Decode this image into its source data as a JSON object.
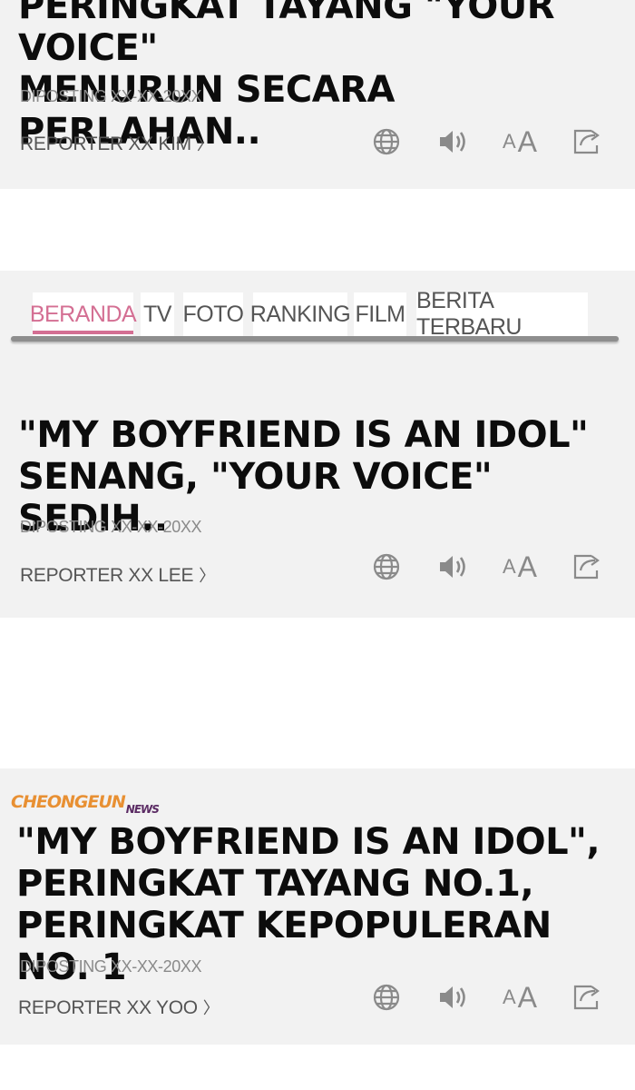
{
  "articles": [
    {
      "headline": "PERINGKAT TAYANG \"YOUR VOICE\"\nMENURUN SECARA PERLAHAN..",
      "date": "DIPOSTING XX-XX-20XX",
      "reporter": "REPORTER XX KIM",
      "chevron": "〉"
    },
    {
      "headline": "\"MY BOYFRIEND IS AN IDOL\"\nSENANG, \"YOUR VOICE\" SEDIH..",
      "date": "DIPOSTING XX-XX-20XX",
      "reporter": "REPORTER XX LEE",
      "chevron": "〉"
    },
    {
      "headline": "\"MY BOYFRIEND IS AN IDOL\",\nPERINGKAT TAYANG NO.1,\nPERINGKAT KEPOPULERAN NO. 1",
      "date": "DIPOSTING XX-XX-20XX",
      "reporter": "REPORTER XX YOO",
      "chevron": "〉"
    }
  ],
  "tools": {
    "icons": [
      "globe-icon",
      "speaker-icon",
      "font-size-icon",
      "share-icon"
    ],
    "font_small": "A",
    "font_big": "A"
  },
  "nav": {
    "tabs": [
      "BERANDA",
      "TV",
      "FOTO",
      "RANKING",
      "FILM",
      "BERITA TERBARU"
    ],
    "active_tab": "BERANDA"
  },
  "logo": {
    "main": "CHEONGEUN",
    "sub": "NEWS"
  },
  "colors": {
    "accent": "#d46f93",
    "card_bg": "#f2f2f2",
    "icon": "#8a8a8a",
    "logo_orange": "#e89033",
    "logo_purple": "#5a2a63"
  }
}
